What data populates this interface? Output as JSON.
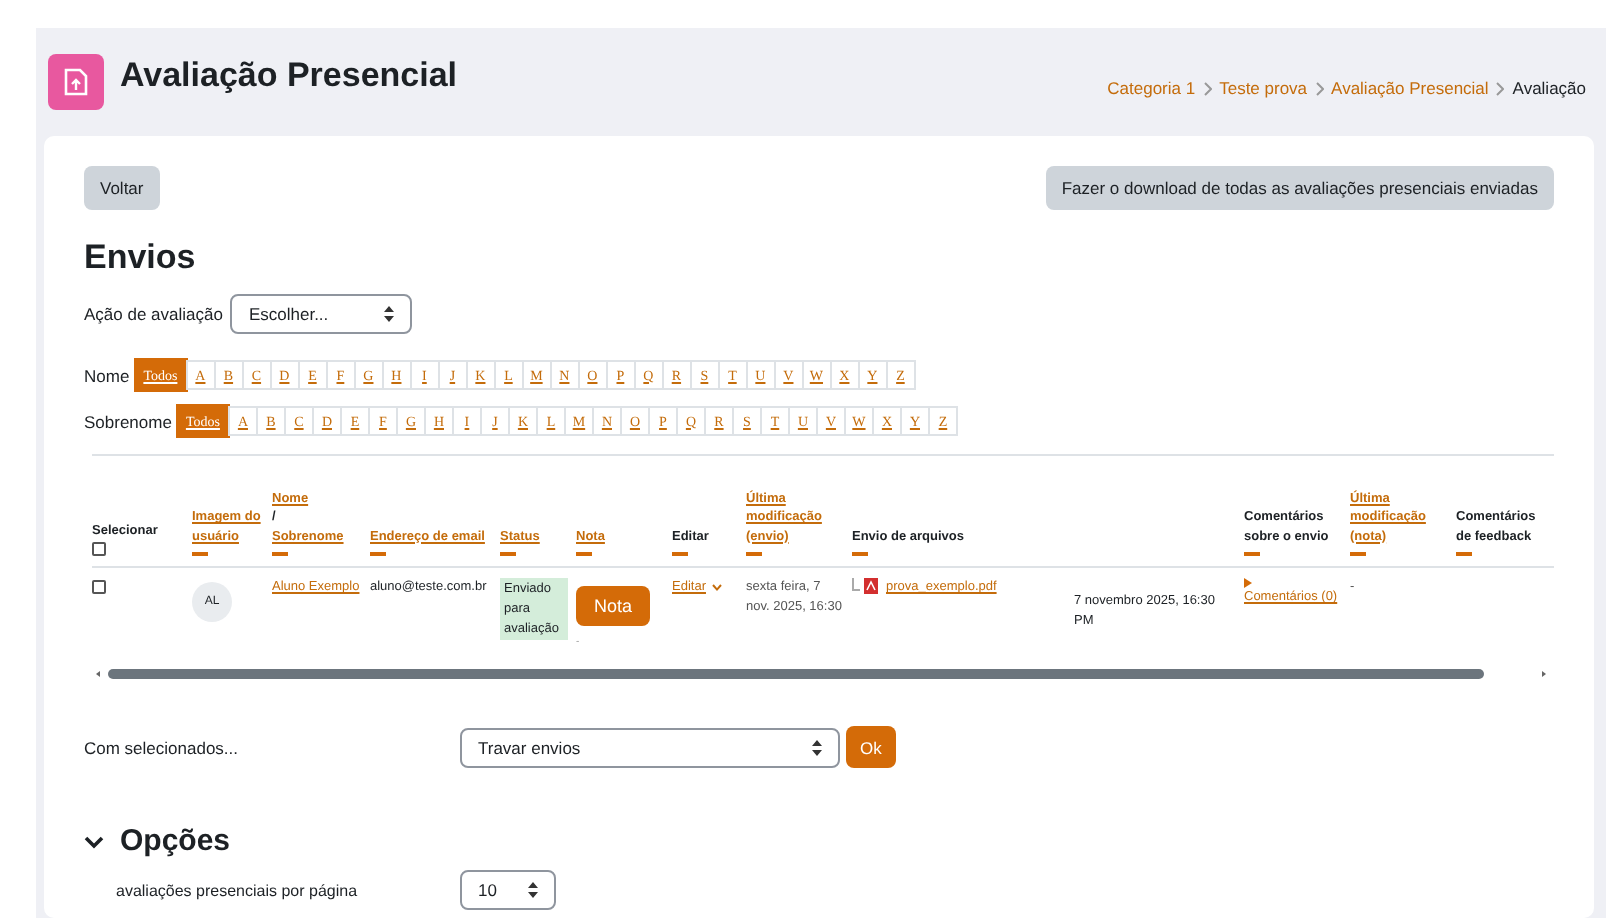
{
  "header": {
    "title": "Avaliação Presencial",
    "breadcrumb": [
      {
        "label": "Categoria 1",
        "link": true
      },
      {
        "label": "Teste prova",
        "link": true
      },
      {
        "label": "Avaliação Presencial",
        "link": true
      },
      {
        "label": "Avaliação",
        "link": false
      }
    ]
  },
  "buttons": {
    "back": "Voltar",
    "download": "Fazer o download de todas as avaliações presenciais enviadas"
  },
  "heading": "Envios",
  "grading_action": {
    "label": "Ação de avaliação",
    "value": "Escolher..."
  },
  "initials_bars": [
    {
      "label": "Nome",
      "letters": [
        {
          "label": "Todos",
          "selected": true
        },
        {
          "label": "A",
          "selected": false
        },
        {
          "label": "B",
          "selected": false
        },
        {
          "label": "C",
          "selected": false
        },
        {
          "label": "D",
          "selected": false
        },
        {
          "label": "E",
          "selected": false
        },
        {
          "label": "F",
          "selected": false
        },
        {
          "label": "G",
          "selected": false
        },
        {
          "label": "H",
          "selected": false
        },
        {
          "label": "I",
          "selected": false
        },
        {
          "label": "J",
          "selected": false
        },
        {
          "label": "K",
          "selected": false
        },
        {
          "label": "L",
          "selected": false
        },
        {
          "label": "M",
          "selected": false
        },
        {
          "label": "N",
          "selected": false
        },
        {
          "label": "O",
          "selected": false
        },
        {
          "label": "P",
          "selected": false
        },
        {
          "label": "Q",
          "selected": false
        },
        {
          "label": "R",
          "selected": false
        },
        {
          "label": "S",
          "selected": false
        },
        {
          "label": "T",
          "selected": false
        },
        {
          "label": "U",
          "selected": false
        },
        {
          "label": "V",
          "selected": false
        },
        {
          "label": "W",
          "selected": false
        },
        {
          "label": "X",
          "selected": false
        },
        {
          "label": "Y",
          "selected": false
        },
        {
          "label": "Z",
          "selected": false
        }
      ]
    },
    {
      "label": "Sobrenome",
      "letters": [
        {
          "label": "Todos",
          "selected": true
        },
        {
          "label": "A",
          "selected": false
        },
        {
          "label": "B",
          "selected": false
        },
        {
          "label": "C",
          "selected": false
        },
        {
          "label": "D",
          "selected": false
        },
        {
          "label": "E",
          "selected": false
        },
        {
          "label": "F",
          "selected": false
        },
        {
          "label": "G",
          "selected": false
        },
        {
          "label": "H",
          "selected": false
        },
        {
          "label": "I",
          "selected": false
        },
        {
          "label": "J",
          "selected": false
        },
        {
          "label": "K",
          "selected": false
        },
        {
          "label": "L",
          "selected": false
        },
        {
          "label": "M",
          "selected": false
        },
        {
          "label": "N",
          "selected": false
        },
        {
          "label": "O",
          "selected": false
        },
        {
          "label": "P",
          "selected": false
        },
        {
          "label": "Q",
          "selected": false
        },
        {
          "label": "R",
          "selected": false
        },
        {
          "label": "S",
          "selected": false
        },
        {
          "label": "T",
          "selected": false
        },
        {
          "label": "U",
          "selected": false
        },
        {
          "label": "V",
          "selected": false
        },
        {
          "label": "W",
          "selected": false
        },
        {
          "label": "X",
          "selected": false
        },
        {
          "label": "Y",
          "selected": false
        },
        {
          "label": "Z",
          "selected": false
        }
      ]
    }
  ],
  "table": {
    "columns": [
      {
        "kind": "checkbox",
        "label": "Selecionar",
        "checked": false
      },
      {
        "kind": "sortable",
        "label": "Imagem do usuário"
      },
      {
        "kind": "name_pair",
        "labels": [
          "Nome",
          "Sobrenome"
        ],
        "separator": "/"
      },
      {
        "kind": "sortable",
        "label": "Endereço de email"
      },
      {
        "kind": "sortable",
        "label": "Status"
      },
      {
        "kind": "sortable",
        "label": "Nota"
      },
      {
        "kind": "plain",
        "label": "Editar"
      },
      {
        "kind": "sortable",
        "label": "Última modificação (envio)"
      },
      {
        "kind": "plain",
        "label": "Envio de arquivos"
      },
      {
        "kind": "blank"
      },
      {
        "kind": "plain",
        "label": "Comentários sobre o envio"
      },
      {
        "kind": "sortable",
        "label": "Última modificação (nota)"
      },
      {
        "kind": "plain",
        "label": "Comentários de feedback"
      }
    ],
    "rows": [
      {
        "selected": false,
        "avatar": "AL",
        "name": "Aluno Exemplo",
        "email": "aluno@teste.com.br",
        "status": "Enviado para avaliação",
        "grade_button": "Nota",
        "grade_value": "-",
        "edit": "Editar",
        "modified": "sexta feira, 7 nov. 2025, 16:30",
        "file": "prova_exemplo.pdf",
        "file_date": "7 novembro 2025, 16:30 PM",
        "comments": "Comentários (0)",
        "comments_expanded": false,
        "grade_modified": "-"
      }
    ]
  },
  "with_selected": {
    "label": "Com selecionados...",
    "value": "Travar envios",
    "button": "Ok"
  },
  "options": {
    "title": "Opções",
    "expanded": true,
    "per_page": {
      "label": "avaliações presenciais por página",
      "value": "10"
    }
  }
}
